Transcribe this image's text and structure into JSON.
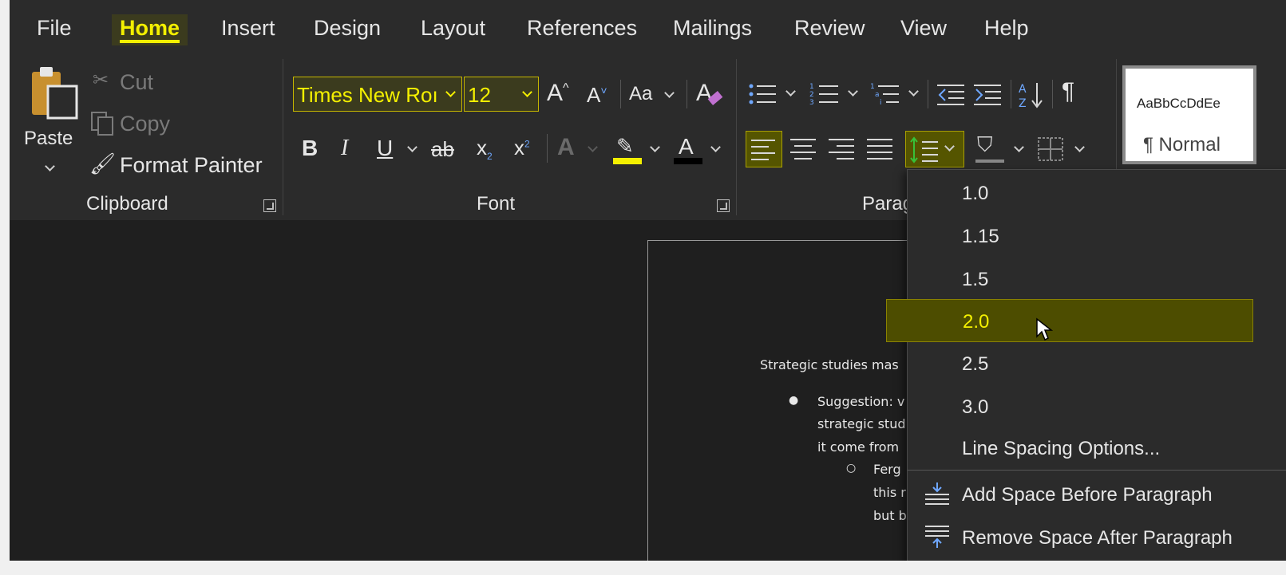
{
  "tabs": [
    {
      "label": "File",
      "active": false
    },
    {
      "label": "Home",
      "active": true
    },
    {
      "label": "Insert",
      "active": false
    },
    {
      "label": "Design",
      "active": false
    },
    {
      "label": "Layout",
      "active": false
    },
    {
      "label": "References",
      "active": false
    },
    {
      "label": "Mailings",
      "active": false
    },
    {
      "label": "Review",
      "active": false
    },
    {
      "label": "View",
      "active": false
    },
    {
      "label": "Help",
      "active": false
    }
  ],
  "clipboard": {
    "paste_label": "Paste",
    "cut_label": "Cut",
    "copy_label": "Copy",
    "format_painter_label": "Format Painter",
    "group_label": "Clipboard"
  },
  "font": {
    "font_name": "Times New Roı",
    "font_size": "12",
    "change_case_label": "Aa",
    "bold": "B",
    "italic": "I",
    "underline": "U",
    "strike": "ab",
    "subscript": "x",
    "superscript": "x",
    "font_color_letter": "A",
    "group_label": "Font",
    "highlight_color": "#f4f000",
    "font_color": "#000000"
  },
  "paragraph": {
    "group_label": "Parag",
    "pilcrow": "¶"
  },
  "styles": {
    "preview": "AaBbCcDdEe",
    "name": "¶ Normal"
  },
  "document": {
    "line1": "Strategic studies mas",
    "bullet1a": "Suggestion: v",
    "bullet1b": "strategic stud",
    "bullet1c": "it come from",
    "sub1a": "Ferg",
    "sub1b": "this r",
    "sub1c": "but b"
  },
  "line_spacing_menu": {
    "items": [
      {
        "label": "1.0",
        "selected": false
      },
      {
        "label": "1.15",
        "selected": false
      },
      {
        "label": "1.5",
        "selected": false
      },
      {
        "label": "2.0",
        "selected": true
      },
      {
        "label": "2.5",
        "selected": false
      },
      {
        "label": "3.0",
        "selected": false
      },
      {
        "label": "Line Spacing Options...",
        "selected": false
      }
    ],
    "add_space_before": "Add Space Before Paragraph",
    "remove_space_after": "Remove Space After Paragraph"
  },
  "colors": {
    "accent": "#f4f000",
    "selected_bg": "#4d4d00",
    "ribbon_bg": "#2b2b2b",
    "canvas_bg": "#1f1f1f"
  }
}
